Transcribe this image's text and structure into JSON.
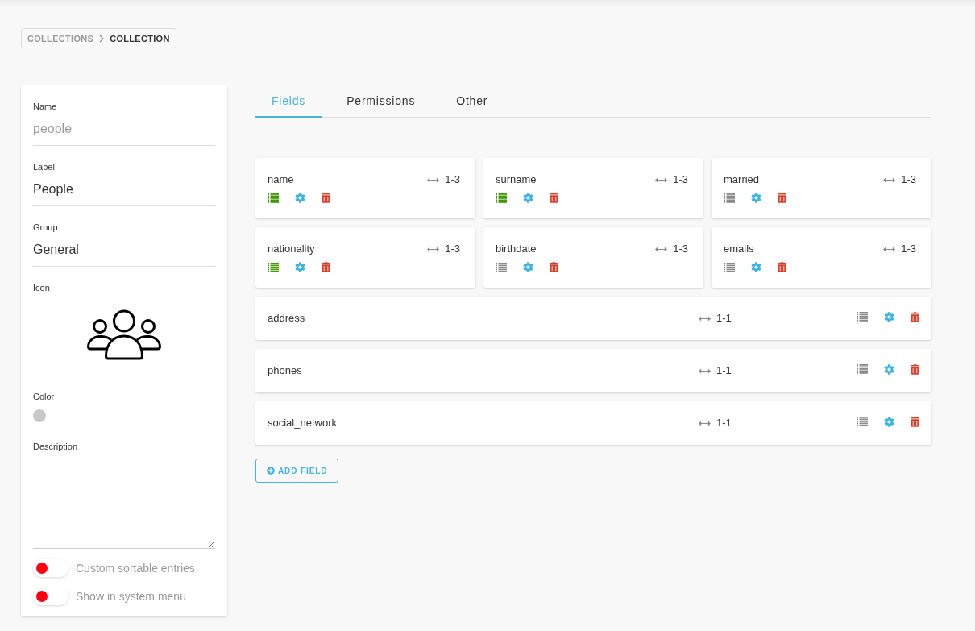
{
  "breadcrumb": [
    {
      "label": "COLLECTIONS",
      "current": false
    },
    {
      "label": "COLLECTION",
      "current": true
    }
  ],
  "form": {
    "name": {
      "label": "Name",
      "value": "people",
      "disabled": true
    },
    "label": {
      "label": "Label",
      "value": "People",
      "disabled": false
    },
    "group": {
      "label": "Group",
      "value": "General",
      "disabled": false
    },
    "icon": {
      "label": "Icon"
    },
    "color": {
      "label": "Color",
      "color": "#c8c8c8"
    },
    "description": {
      "label": "Description"
    },
    "toggles": [
      {
        "label": "Custom sortable entries",
        "on": false
      },
      {
        "label": "Show in system menu",
        "on": false
      }
    ]
  },
  "tabs": [
    {
      "label": "Fields",
      "selected": true
    },
    {
      "label": "Permissions",
      "selected": false
    },
    {
      "label": "Other",
      "selected": false
    }
  ],
  "fields": [
    {
      "name": "name",
      "kind": "tile",
      "width": "1-3",
      "show_in_list": true
    },
    {
      "name": "surname",
      "kind": "tile",
      "width": "1-3",
      "show_in_list": true
    },
    {
      "name": "married",
      "kind": "tile",
      "width": "1-3",
      "show_in_list": false
    },
    {
      "name": "nationality",
      "kind": "tile",
      "width": "1-3",
      "show_in_list": true
    },
    {
      "name": "birthdate",
      "kind": "tile",
      "width": "1-3",
      "show_in_list": false
    },
    {
      "name": "emails",
      "kind": "tile",
      "width": "1-3",
      "show_in_list": false
    },
    {
      "name": "address",
      "kind": "row",
      "width": "1-1",
      "show_in_list": false
    },
    {
      "name": "phones",
      "kind": "row",
      "width": "1-1",
      "show_in_list": false
    },
    {
      "name": "social_network",
      "kind": "row",
      "width": "1-1",
      "show_in_list": false
    }
  ],
  "add_button": {
    "label": "ADD FIELD"
  }
}
